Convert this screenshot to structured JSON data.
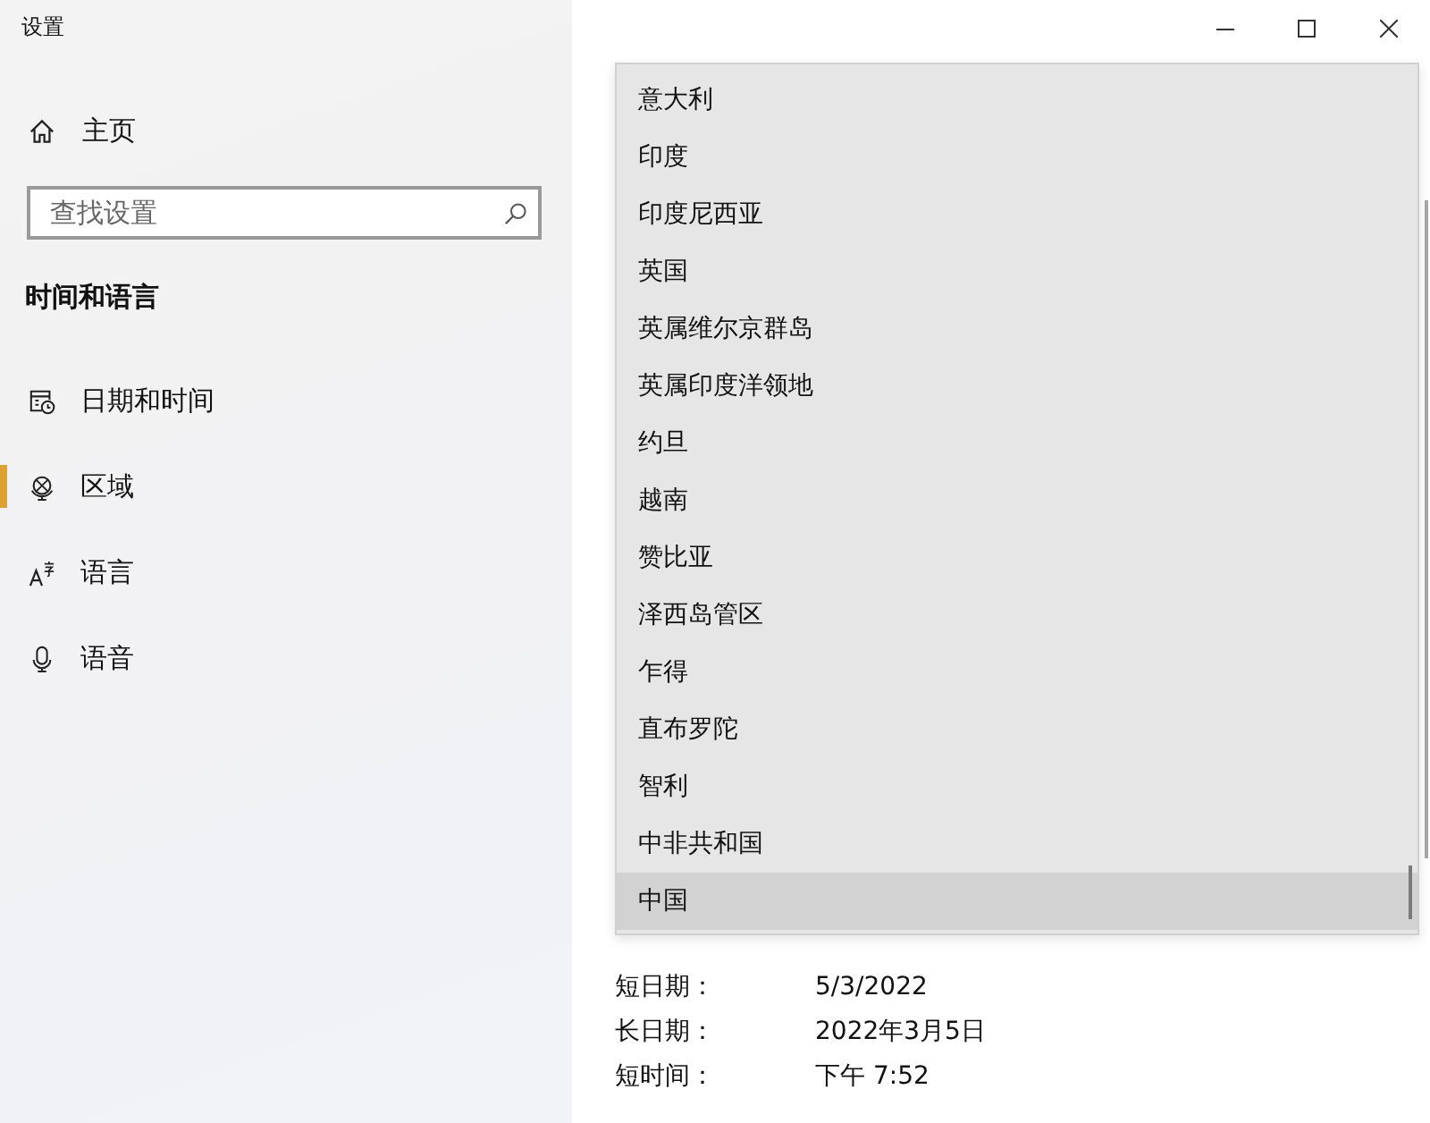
{
  "window": {
    "title": "设置"
  },
  "sidebar": {
    "home": "主页",
    "search": {
      "placeholder": "查找设置"
    },
    "section_title": "时间和语言",
    "items": [
      {
        "label": "日期和时间",
        "selected": false
      },
      {
        "label": "区域",
        "selected": true
      },
      {
        "label": "语言",
        "selected": false
      },
      {
        "label": "语音",
        "selected": false
      }
    ]
  },
  "region_dropdown": {
    "options": [
      {
        "label": "意大利",
        "selected": false
      },
      {
        "label": "印度",
        "selected": false
      },
      {
        "label": "印度尼西亚",
        "selected": false
      },
      {
        "label": "英国",
        "selected": false
      },
      {
        "label": "英属维尔京群岛",
        "selected": false
      },
      {
        "label": "英属印度洋领地",
        "selected": false
      },
      {
        "label": "约旦",
        "selected": false
      },
      {
        "label": "越南",
        "selected": false
      },
      {
        "label": "赞比亚",
        "selected": false
      },
      {
        "label": "泽西岛管区",
        "selected": false
      },
      {
        "label": "乍得",
        "selected": false
      },
      {
        "label": "直布罗陀",
        "selected": false
      },
      {
        "label": "智利",
        "selected": false
      },
      {
        "label": "中非共和国",
        "selected": false
      },
      {
        "label": "中国",
        "selected": true
      }
    ]
  },
  "regional_format": {
    "rows": [
      {
        "label": "短日期：",
        "value": "5/3/2022"
      },
      {
        "label": "长日期：",
        "value": "2022年3月5日"
      },
      {
        "label": "短时间：",
        "value": "下午 7:52"
      }
    ]
  }
}
